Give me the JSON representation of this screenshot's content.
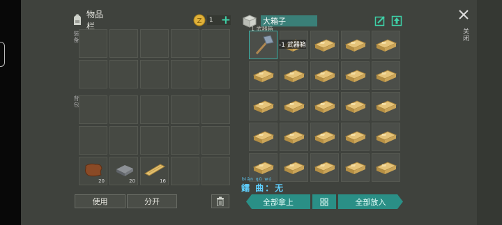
{
  "inventory": {
    "title": "物品栏",
    "coin_count": "1",
    "add_symbol": "+",
    "vlabel_top": "装备",
    "vlabel_bottom": "背包",
    "items": [
      {
        "name": "leather",
        "count": "20"
      },
      {
        "name": "iron-ingot",
        "count": "20"
      },
      {
        "name": "wooden-plank",
        "count": "16"
      }
    ],
    "use_button": "使用",
    "split_button": "分开"
  },
  "chest": {
    "name_value": "大箱子",
    "first_item_label": "1 武器箱",
    "first_item_tag": "-1 武器箱",
    "close_label": "关闭",
    "take_all_button": "全部拿上",
    "put_all_button": "全部放入",
    "pinyin": "biān  qū  wú",
    "watermark": "鑐 曲：无",
    "item_icon": "gold-ingot-icon",
    "first_item_icon": "sledgehammer-icon"
  },
  "colors": {
    "teal": "#2a8f86",
    "gold": "#d8b060",
    "background": "#3f423d"
  }
}
